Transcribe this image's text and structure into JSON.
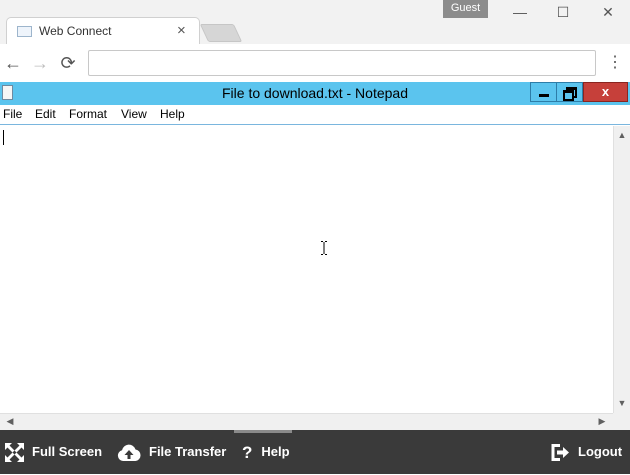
{
  "browser": {
    "profile_label": "Guest",
    "tab": {
      "title": "Web Connect",
      "close_glyph": "×"
    },
    "window_controls": {
      "minimize": "—",
      "maximize": "☐",
      "close": "✕"
    },
    "nav": {
      "back_glyph": "←",
      "forward_glyph": "→",
      "reload_glyph": "⟳",
      "menu_glyph": "⋮"
    },
    "omnibox_value": ""
  },
  "notepad": {
    "title": "File to download.txt - Notepad",
    "close_glyph": "x",
    "menu": [
      "File",
      "Edit",
      "Format",
      "View",
      "Help"
    ],
    "content": ""
  },
  "bottom_bar": {
    "full_screen": "Full Screen",
    "file_transfer": "File Transfer",
    "help": "Help",
    "logout": "Logout"
  },
  "colors": {
    "notepad_titlebar": "#5bc4ee",
    "close_button": "#c6403a",
    "bottom_bar": "#3a3a3a"
  },
  "icons": [
    "page-icon",
    "back-arrow-icon",
    "forward-arrow-icon",
    "reload-icon",
    "menu-dots-icon",
    "notepad-icon",
    "fullscreen-icon",
    "cloud-upload-icon",
    "help-icon",
    "logout-icon",
    "text-cursor-icon"
  ]
}
